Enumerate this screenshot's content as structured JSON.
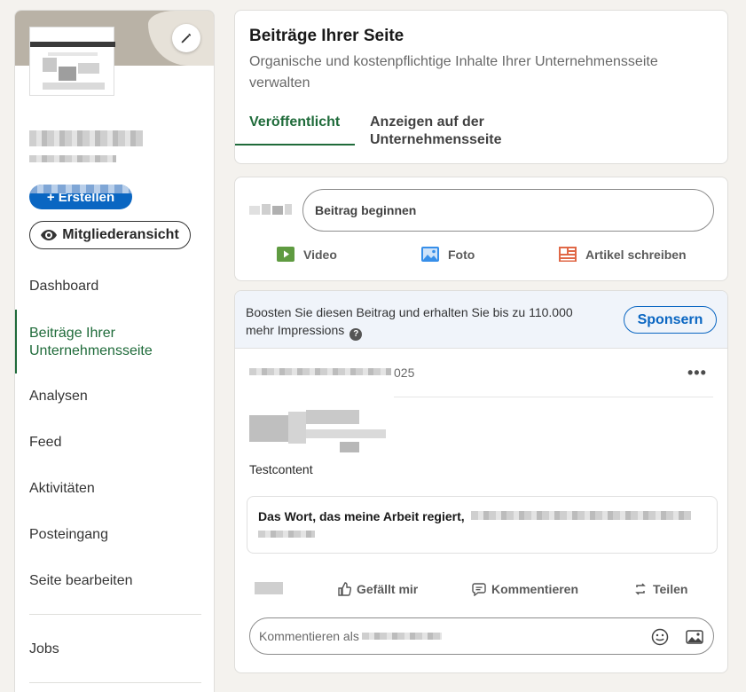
{
  "sidebar": {
    "create_label": "+ Erstellen",
    "member_view_label": "Mitgliederansicht",
    "nav": [
      {
        "label": "Dashboard"
      },
      {
        "label": "Beiträge Ihrer Unternehmensseite"
      },
      {
        "label": "Analysen"
      },
      {
        "label": "Feed"
      },
      {
        "label": "Aktivitäten"
      },
      {
        "label": "Posteingang"
      },
      {
        "label": "Seite bearbeiten"
      },
      {
        "label": "Jobs"
      }
    ]
  },
  "header": {
    "title": "Beiträge Ihrer Seite",
    "subtitle": "Organische und kostenpflichtige Inhalte Ihrer Unternehmensseite verwalten",
    "tabs": [
      {
        "label": "Veröffentlicht"
      },
      {
        "label": "Anzeigen auf der Unternehmensseite"
      }
    ]
  },
  "composer": {
    "placeholder": "Beitrag beginnen",
    "actions": [
      {
        "label": "Video",
        "icon": "video-icon"
      },
      {
        "label": "Foto",
        "icon": "photo-icon"
      },
      {
        "label": "Artikel schreiben",
        "icon": "article-icon"
      }
    ]
  },
  "post": {
    "boost_text": "Boosten Sie diesen Beitrag und erhalten Sie bis zu 110.000 mehr Impressions",
    "sponsor_label": "Sponsern",
    "date_suffix": "025",
    "body_text": "Testcontent",
    "quote_text": "Das Wort, das meine Arbeit regiert,",
    "actions": [
      {
        "label": "Gefällt mir",
        "icon": "like-icon"
      },
      {
        "label": "Kommentieren",
        "icon": "comment-icon"
      },
      {
        "label": "Teilen",
        "icon": "repost-icon"
      }
    ],
    "comment_placeholder": "Kommentieren als"
  },
  "colors": {
    "accent_green": "#1f6b3a",
    "brand_blue": "#0a66c2",
    "page_bg": "#f4f2ee"
  }
}
